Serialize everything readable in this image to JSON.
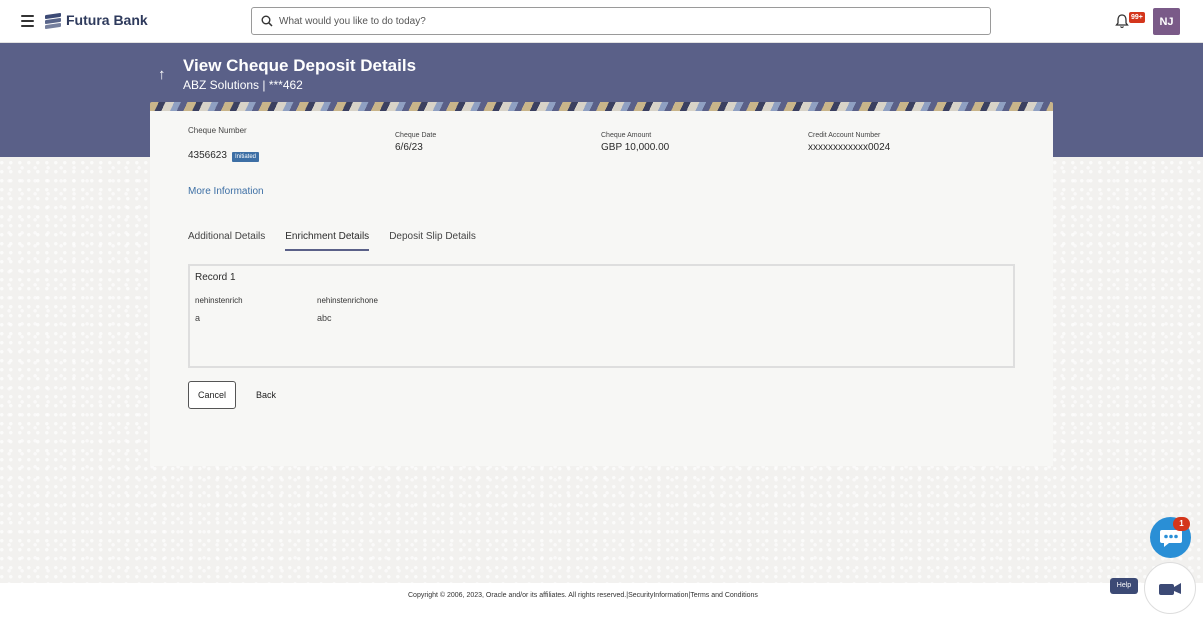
{
  "header": {
    "brand": "Futura Bank",
    "search_placeholder": "What would you like to do today?",
    "notification_badge": "99+",
    "user_initials": "NJ"
  },
  "banner": {
    "title": "View Cheque Deposit Details",
    "subtitle": "ABZ Solutions | ***462"
  },
  "cheque": {
    "number_label": "Cheque Number",
    "number_value": "4356623",
    "status": "Initiated",
    "date_label": "Cheque Date",
    "date_value": "6/6/23",
    "amount_label": "Cheque Amount",
    "amount_value": "GBP 10,000.00",
    "account_label": "Credit Account Number",
    "account_value": "xxxxxxxxxxxx0024",
    "more_info": "More Information"
  },
  "tabs": [
    {
      "label": "Additional Details",
      "active": false
    },
    {
      "label": "Enrichment Details",
      "active": true
    },
    {
      "label": "Deposit Slip Details",
      "active": false
    }
  ],
  "record": {
    "title": "Record 1",
    "fields": [
      {
        "label": "nehinstenrich",
        "value": "a"
      },
      {
        "label": "nehinstenrichone",
        "value": "abc"
      }
    ]
  },
  "actions": {
    "cancel": "Cancel",
    "back": "Back"
  },
  "footer": {
    "copyright": "Copyright © 2006, 2023, Oracle and/or its affiliates. All rights reserved.|",
    "security": "SecurityInformation",
    "separator": "|",
    "terms": "Terms and Conditions"
  },
  "widgets": {
    "chat_count": "1",
    "help": "Help"
  },
  "colors": {
    "banner": "#5a6088",
    "accent": "#3d6fa5",
    "badge": "#d4361c",
    "chat": "#2a8fd6"
  }
}
